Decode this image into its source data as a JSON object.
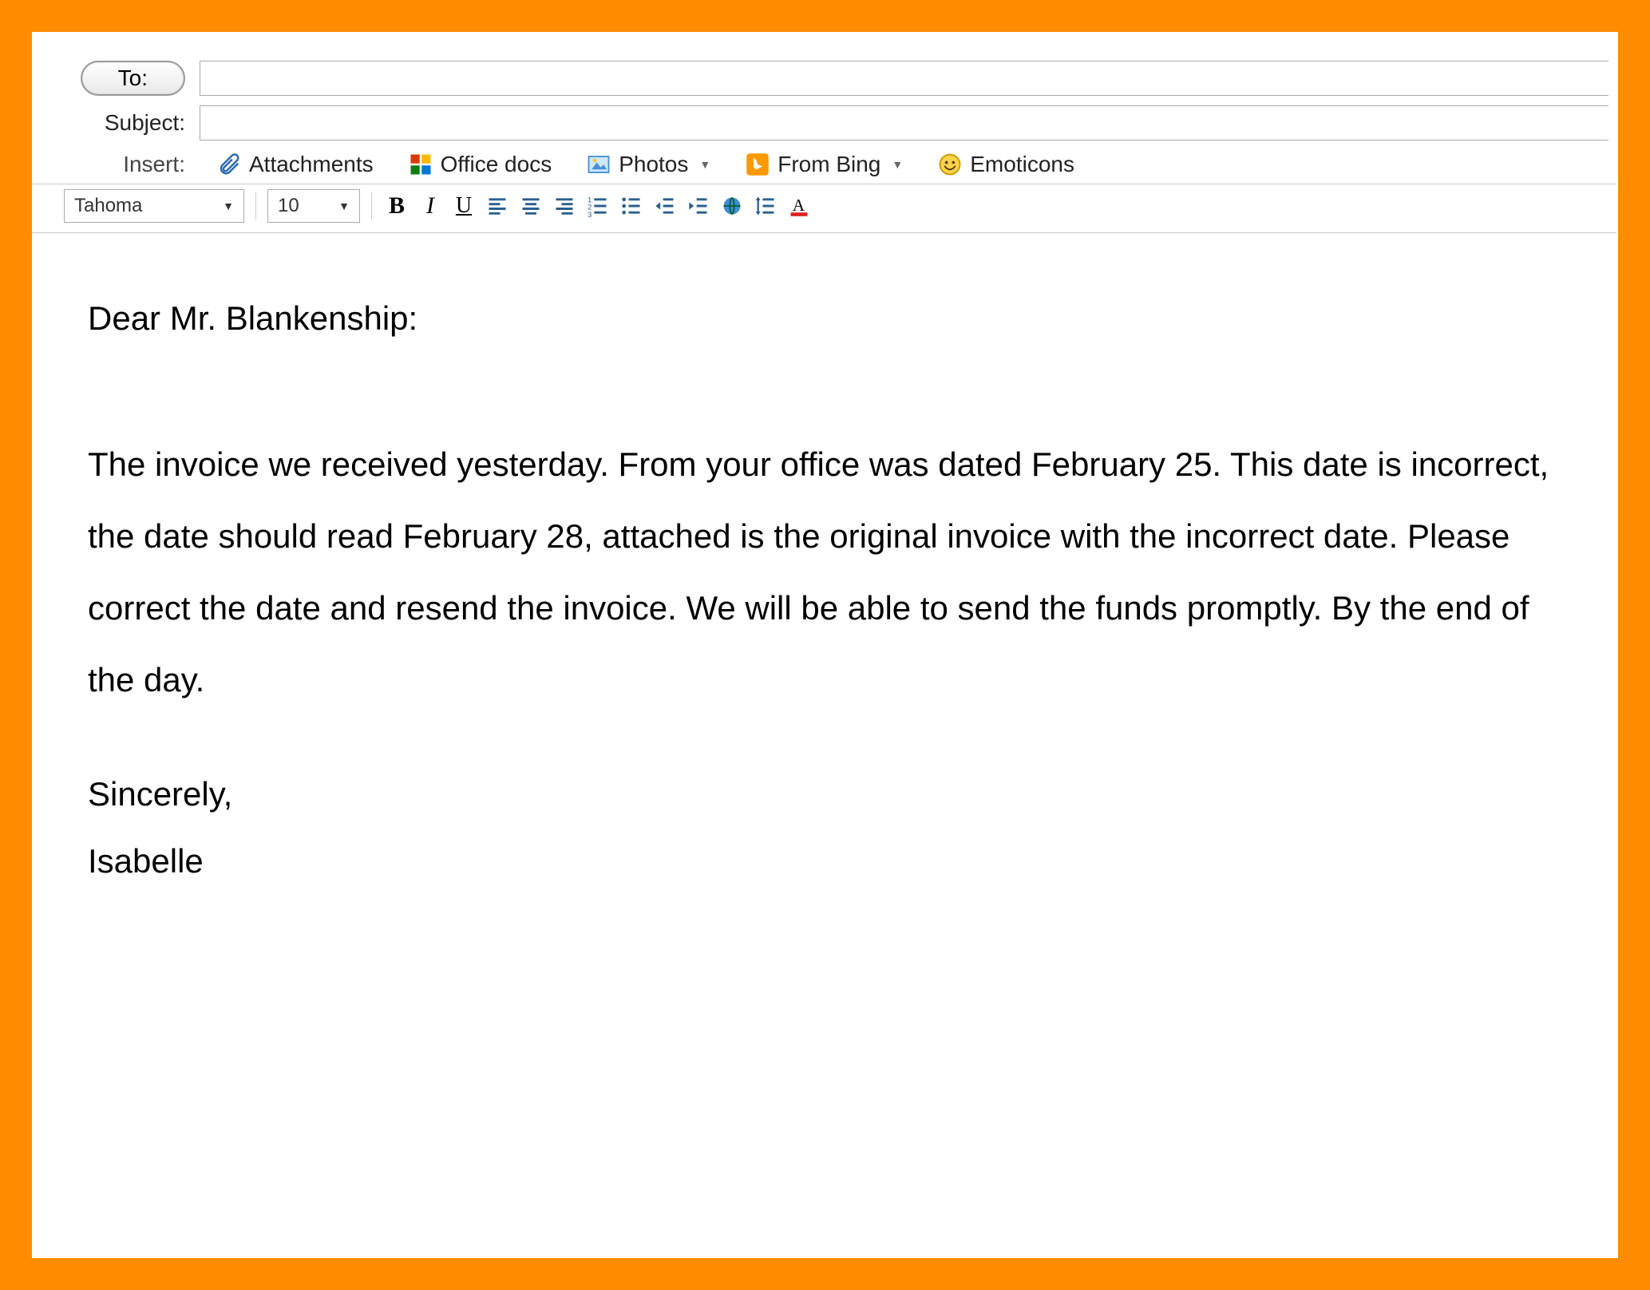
{
  "header": {
    "to_label": "To:",
    "subject_label": "Subject:",
    "to_value": "",
    "subject_value": ""
  },
  "insert": {
    "label": "Insert:",
    "items": [
      {
        "label": "Attachments",
        "icon": "paperclip",
        "dropdown": false
      },
      {
        "label": "Office docs",
        "icon": "office",
        "dropdown": false
      },
      {
        "label": "Photos",
        "icon": "photo",
        "dropdown": true
      },
      {
        "label": "From Bing",
        "icon": "bing",
        "dropdown": true
      },
      {
        "label": "Emoticons",
        "icon": "emoticon",
        "dropdown": false
      }
    ]
  },
  "toolbar": {
    "font_name": "Tahoma",
    "font_size": "10",
    "buttons": [
      "bold",
      "italic",
      "underline",
      "align-left",
      "align-center",
      "align-right",
      "ordered-list",
      "unordered-list",
      "outdent",
      "indent",
      "insert-link",
      "line-height",
      "font-color"
    ]
  },
  "mail": {
    "greeting": "Dear Mr. Blankenship:",
    "body": "The invoice we received yesterday. From your office was dated February 25.  This date is incorrect, the date should read February 28, attached is the original invoice with the incorrect date. Please correct the date and resend the invoice. We will be able to send the funds promptly. By the end of the day.",
    "signoff": "Sincerely,",
    "signature": "Isabelle"
  }
}
